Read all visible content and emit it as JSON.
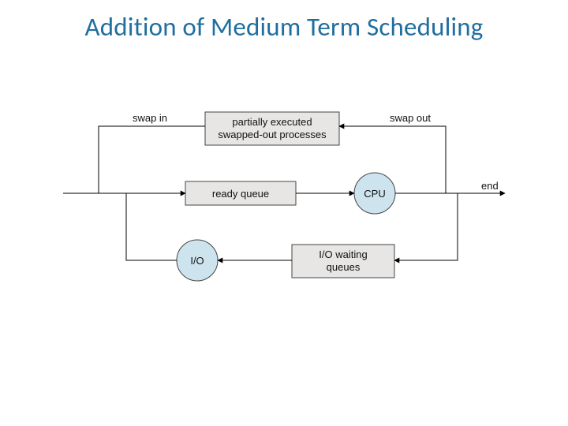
{
  "title": "Addition of Medium Term Scheduling",
  "diagram": {
    "swap_in": "swap in",
    "swap_out": "swap out",
    "end": "end",
    "partial1": "partially executed",
    "partial2": "swapped-out processes",
    "ready_queue": "ready queue",
    "cpu": "CPU",
    "io": "I/O",
    "io_wait1": "I/O waiting",
    "io_wait2": "queues"
  }
}
